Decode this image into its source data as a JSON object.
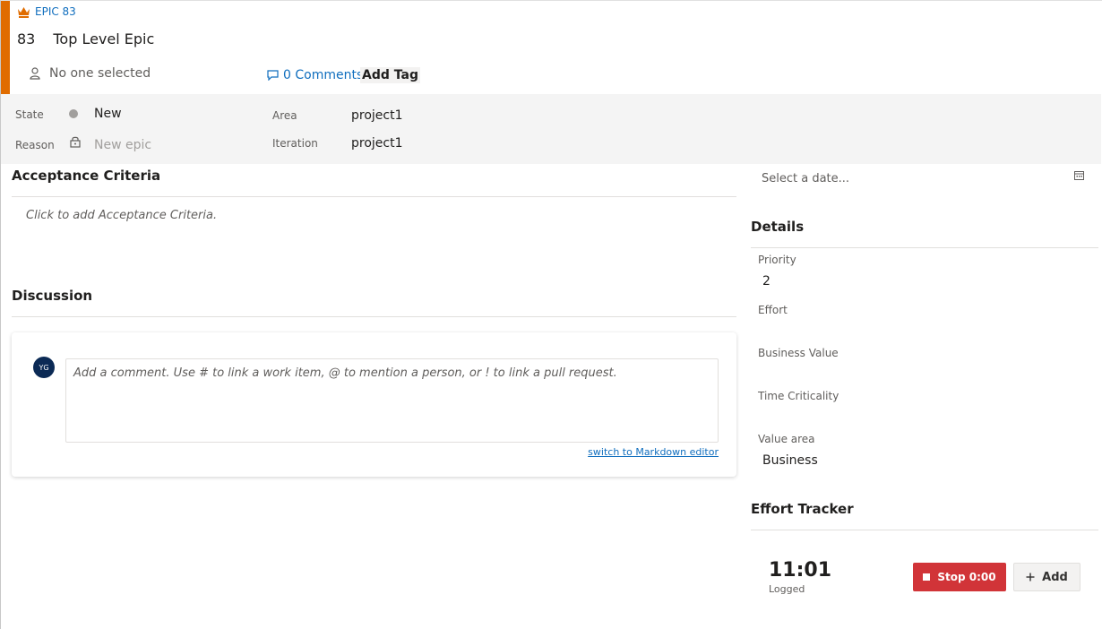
{
  "header": {
    "type_label": "EPIC 83",
    "id": "83",
    "title": "Top Level Epic",
    "assignee": "No one selected",
    "comments_label": "0 Comments",
    "add_tag_label": "Add Tag",
    "accent_color": "#e06c00"
  },
  "fields": {
    "state_label": "State",
    "state_value": "New",
    "reason_label": "Reason",
    "reason_value": "New epic",
    "area_label": "Area",
    "area_value": "project1",
    "iteration_label": "Iteration",
    "iteration_value": "project1"
  },
  "acceptance": {
    "title": "Acceptance Criteria",
    "placeholder": "Click to add Acceptance Criteria."
  },
  "discussion": {
    "title": "Discussion",
    "avatar_initials": "YG",
    "comment_placeholder": "Add a comment. Use # to link a work item, @ to mention a person, or ! to link a pull request.",
    "markdown_link": "switch to Markdown editor"
  },
  "date_field": {
    "placeholder": "Select a date..."
  },
  "details": {
    "title": "Details",
    "priority_label": "Priority",
    "priority_value": "2",
    "effort_label": "Effort",
    "business_value_label": "Business Value",
    "time_criticality_label": "Time Criticality",
    "value_area_label": "Value area",
    "value_area_value": "Business"
  },
  "tracker": {
    "title": "Effort Tracker",
    "time": "11:01",
    "logged_label": "Logged",
    "stop_label": "Stop 0:00",
    "add_label": "Add",
    "stop_color": "#d13438"
  },
  "icons": {
    "crown": "crown-icon",
    "person": "person-icon",
    "comment": "comment-icon",
    "lock": "lock-icon",
    "calendar": "calendar-icon",
    "stop": "stop-icon",
    "plus": "plus-icon"
  }
}
